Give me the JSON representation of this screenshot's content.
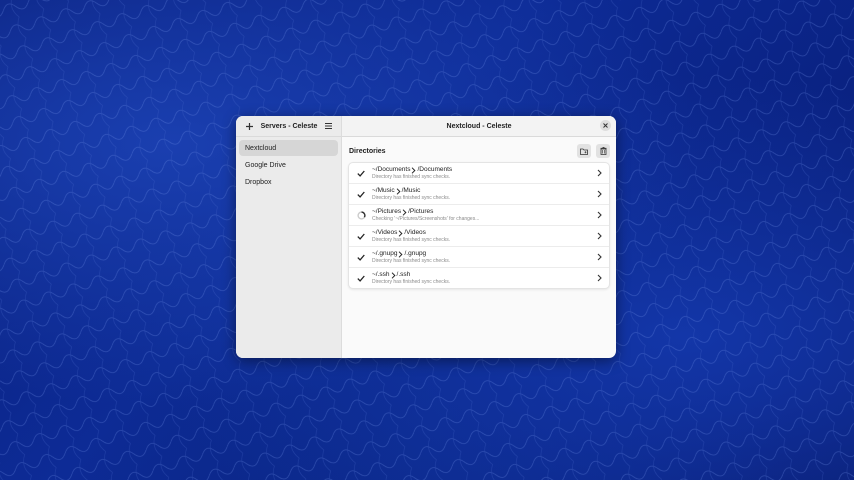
{
  "sidebar": {
    "add_icon": "plus-icon",
    "title": "Servers - Celeste",
    "menu_icon": "hamburger-menu-icon",
    "servers": [
      {
        "label": "Nextcloud",
        "selected": true
      },
      {
        "label": "Google Drive",
        "selected": false
      },
      {
        "label": "Dropbox",
        "selected": false
      }
    ]
  },
  "main": {
    "title": "Nextcloud - Celeste",
    "close_icon": "close-icon",
    "section_label": "Directories",
    "toolbar_icons": [
      "add-folder-icon",
      "trash-icon"
    ],
    "directories": [
      {
        "local": "~/Documents",
        "remote": "/Documents",
        "status": "Directory has finished sync checks.",
        "state": "done"
      },
      {
        "local": "~/Music",
        "remote": "/Music",
        "status": "Directory has finished sync checks.",
        "state": "done"
      },
      {
        "local": "~/Pictures",
        "remote": "/Pictures",
        "status": "Checking '~/Pictures/Screenshots' for changes...",
        "state": "syncing"
      },
      {
        "local": "~/Videos",
        "remote": "/Videos",
        "status": "Directory has finished sync checks.",
        "state": "done"
      },
      {
        "local": "~/.gnupg",
        "remote": "/.gnupg",
        "status": "Directory has finished sync checks.",
        "state": "done"
      },
      {
        "local": "~/.ssh",
        "remote": "/.ssh",
        "status": "Directory has finished sync checks.",
        "state": "done"
      }
    ]
  },
  "colors": {
    "wallpaper": "#0d2b96",
    "window_bg": "#fafafa",
    "sidebar_bg": "#ebebeb",
    "selected_bg": "#d6d6d6"
  }
}
